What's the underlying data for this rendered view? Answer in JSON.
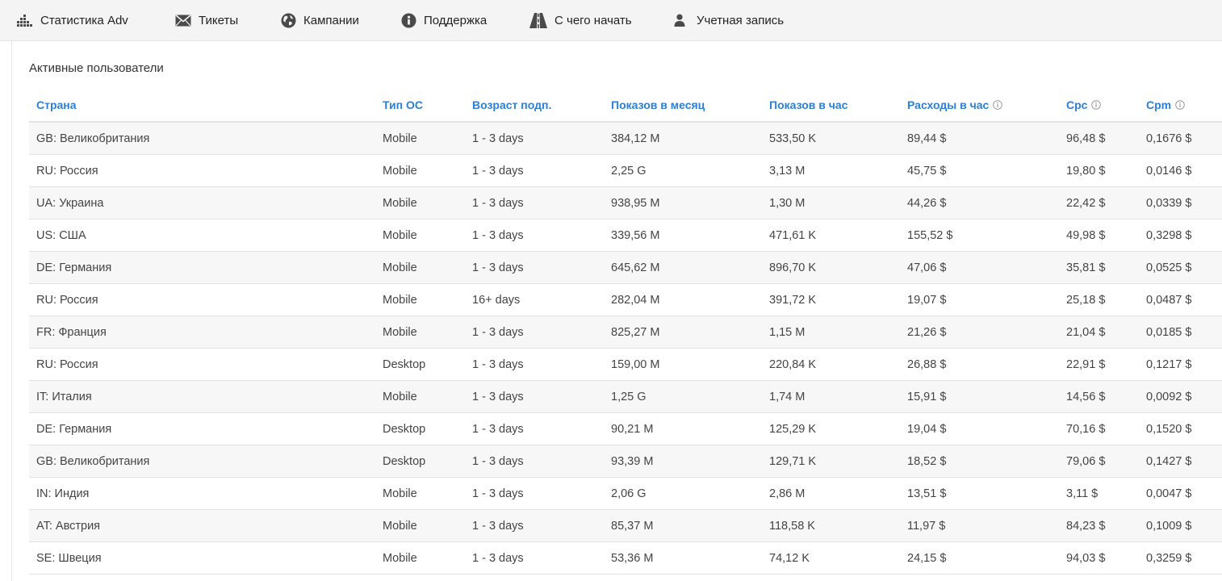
{
  "nav": {
    "items": [
      {
        "label": "Статистика Adv",
        "icon": "bar-chart-icon"
      },
      {
        "label": "Тикеты",
        "icon": "envelope-icon"
      },
      {
        "label": "Кампании",
        "icon": "globe-icon"
      },
      {
        "label": "Поддержка",
        "icon": "info-circle-icon"
      },
      {
        "label": "С чего начать",
        "icon": "road-icon"
      },
      {
        "label": "Учетная запись",
        "icon": "user-icon"
      }
    ]
  },
  "section": {
    "title": "Активные пользователи"
  },
  "table": {
    "headers": [
      "Страна",
      "Тип ОС",
      "Возраст подп.",
      "Показов в месяц",
      "Показов в час",
      "Расходы в час",
      "Cpc",
      "Cpm"
    ],
    "rows": [
      [
        "GB: Великобритания",
        "Mobile",
        "1 - 3 days",
        "384,12 M",
        "533,50 K",
        "89,44 $",
        "96,48 $",
        "0,1676 $"
      ],
      [
        "RU: Россия",
        "Mobile",
        "1 - 3 days",
        "2,25 G",
        "3,13 M",
        "45,75 $",
        "19,80 $",
        "0,0146 $"
      ],
      [
        "UA: Украина",
        "Mobile",
        "1 - 3 days",
        "938,95 M",
        "1,30 M",
        "44,26 $",
        "22,42 $",
        "0,0339 $"
      ],
      [
        "US: США",
        "Mobile",
        "1 - 3 days",
        "339,56 M",
        "471,61 K",
        "155,52 $",
        "49,98 $",
        "0,3298 $"
      ],
      [
        "DE: Германия",
        "Mobile",
        "1 - 3 days",
        "645,62 M",
        "896,70 K",
        "47,06 $",
        "35,81 $",
        "0,0525 $"
      ],
      [
        "RU: Россия",
        "Mobile",
        "16+ days",
        "282,04 M",
        "391,72 K",
        "19,07 $",
        "25,18 $",
        "0,0487 $"
      ],
      [
        "FR: Франция",
        "Mobile",
        "1 - 3 days",
        "825,27 M",
        "1,15 M",
        "21,26 $",
        "21,04 $",
        "0,0185 $"
      ],
      [
        "RU: Россия",
        "Desktop",
        "1 - 3 days",
        "159,00 M",
        "220,84 K",
        "26,88 $",
        "22,91 $",
        "0,1217 $"
      ],
      [
        "IT: Италия",
        "Mobile",
        "1 - 3 days",
        "1,25 G",
        "1,74 M",
        "15,91 $",
        "14,56 $",
        "0,0092 $"
      ],
      [
        "DE: Германия",
        "Desktop",
        "1 - 3 days",
        "90,21 M",
        "125,29 K",
        "19,04 $",
        "70,16 $",
        "0,1520 $"
      ],
      [
        "GB: Великобритания",
        "Desktop",
        "1 - 3 days",
        "93,39 M",
        "129,71 K",
        "18,52 $",
        "79,06 $",
        "0,1427 $"
      ],
      [
        "IN: Индия",
        "Mobile",
        "1 - 3 days",
        "2,06 G",
        "2,86 M",
        "13,51 $",
        "3,11 $",
        "0,0047 $"
      ],
      [
        "AT: Австрия",
        "Mobile",
        "1 - 3 days",
        "85,37 M",
        "118,58 K",
        "11,97 $",
        "84,23 $",
        "0,1009 $"
      ],
      [
        "SE: Швеция",
        "Mobile",
        "1 - 3 days",
        "53,36 M",
        "74,12 K",
        "24,15 $",
        "94,03 $",
        "0,3259 $"
      ]
    ]
  },
  "colors": {
    "header_text": "#2d7fd3",
    "nav_background": "#f4f4f4",
    "row_stripe": "#f7f7f7",
    "icon": "#444444"
  }
}
